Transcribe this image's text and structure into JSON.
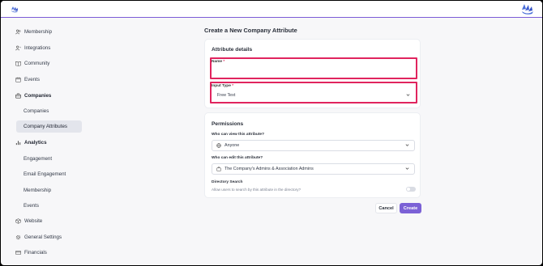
{
  "brand": {
    "accent": "#7c5cd6",
    "highlight": "#e0245e",
    "logo_icon": "hands-logo-icon"
  },
  "sidebar": {
    "items": [
      {
        "label": "Membership",
        "icon": "users-icon"
      },
      {
        "label": "Integrations",
        "icon": "integrations-icon"
      },
      {
        "label": "Community",
        "icon": "book-icon"
      },
      {
        "label": "Events",
        "icon": "calendar-icon"
      },
      {
        "label": "Companies",
        "icon": "briefcase-icon"
      },
      {
        "label": "Companies"
      },
      {
        "label": "Company Attributes"
      },
      {
        "label": "Analytics",
        "icon": "bar-chart-icon"
      },
      {
        "label": "Engagement"
      },
      {
        "label": "Email Engagement"
      },
      {
        "label": "Membership"
      },
      {
        "label": "Events"
      },
      {
        "label": "Website",
        "icon": "cube-icon"
      },
      {
        "label": "General Settings",
        "icon": "gear-icon"
      },
      {
        "label": "Financials",
        "icon": "card-icon"
      }
    ]
  },
  "page": {
    "title": "Create a New Company Attribute"
  },
  "details": {
    "title": "Attribute details",
    "name_label": "Name",
    "name_value": "",
    "input_type_label": "Input Type",
    "input_type_value": "Free Text"
  },
  "permissions": {
    "title": "Permissions",
    "view_label": "Who can view this attribute?",
    "view_value": "Anyone",
    "edit_label": "Who can edit this attribute?",
    "edit_value": "The Company's Admins & Association Admins",
    "directory_label": "Directory Search",
    "directory_hint": "Allow users to search by this attribute in the directory?",
    "directory_enabled": false
  },
  "actions": {
    "cancel": "Cancel",
    "create": "Create"
  }
}
